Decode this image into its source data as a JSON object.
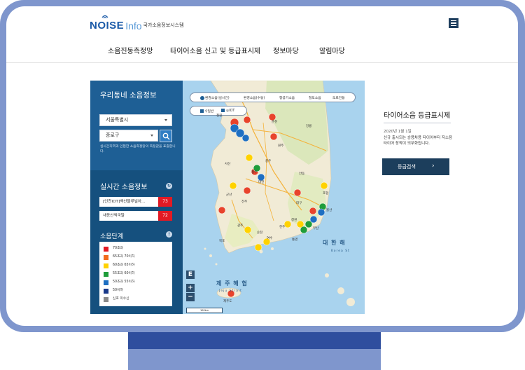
{
  "header": {
    "logo_noise": "NOISE",
    "logo_info": "Info",
    "logo_sub": "국가소음정보시스템",
    "menu_icon": "hamburger-menu-icon"
  },
  "nav": {
    "items": [
      "소음진동측정망",
      "타이어소음 신고 및 등급표시제",
      "정보마당",
      "알림마당"
    ]
  },
  "left_panel": {
    "title": "우리동네 소음정보",
    "city_select": "서울특별시",
    "district_select": "종로구",
    "note": "실시간지역과 인접한 소음측정망의 측정값을 표출합니다.",
    "realtime_title": "실시간 소음정보",
    "realtime_rows": [
      {
        "name": "[인천IOT]백산블루빌아...",
        "value": "73"
      },
      {
        "name": "새동산엑국말",
        "value": "72"
      }
    ],
    "level_title": "소음단계",
    "levels": [
      {
        "label": "70초과",
        "color": "#e21a24"
      },
      {
        "label": "65초과 70이하",
        "color": "#f26b1d"
      },
      {
        "label": "60초과 65이하",
        "color": "#ffd200"
      },
      {
        "label": "55초과 60이하",
        "color": "#1f9d3a"
      },
      {
        "label": "50초과 55이하",
        "color": "#1e6fc2"
      },
      {
        "label": "50이하",
        "color": "#1a3a8a"
      },
      {
        "label": "신호 미수신",
        "color": "#8a8a8a"
      }
    ]
  },
  "map": {
    "radios": [
      "환경소음(실시간)",
      "환경소음(수동)",
      "항공기소음",
      "철도소음",
      "도로진동"
    ],
    "checks": [
      "일반",
      "IOT"
    ],
    "scale_label": "100km",
    "zoom_in": "+",
    "zoom_out": "−",
    "east_toggle": "E",
    "sea_east": "대 한 해",
    "sea_east_sub": "Korea St",
    "sea_south": "제 주 해 협",
    "sea_south_sub": "Jeju Strait",
    "place_labels": [
      "강릉",
      "춘천",
      "철원",
      "원주",
      "충주",
      "청주",
      "대전",
      "전주",
      "광주",
      "목포",
      "대구",
      "부산",
      "포항",
      "울산",
      "안동",
      "제주도",
      "여수",
      "순천",
      "창원",
      "진주",
      "통영",
      "서산",
      "군산"
    ]
  },
  "tire": {
    "title": "타이어소음 등급표시제",
    "date": "2020년 1월 1일",
    "desc": "신규 출시되는 승용차용 타이어부터 저소음 타이어 장착이 의무화됩니다.",
    "button_label": "등급검색",
    "button_arrow": "›"
  },
  "colors": {
    "frame": "#7f96cd",
    "stand_dark": "#2f4e9e",
    "panel": "#1e5f95",
    "panel_dark": "#15507e",
    "button": "#1c3e5c",
    "accent_red": "#e21a24"
  }
}
